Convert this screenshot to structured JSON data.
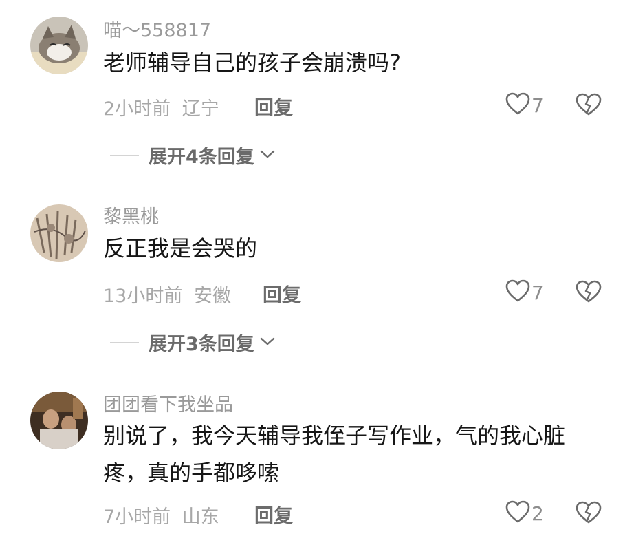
{
  "comments": [
    {
      "username": "喵～558817",
      "text": "老师辅导自己的孩子会崩溃吗?",
      "time": "2小时前",
      "location": "辽宁",
      "reply_label": "回复",
      "likes": "7",
      "expand_label": "展开4条回复"
    },
    {
      "username": "黎黑桃",
      "text": "反正我是会哭的",
      "time": "13小时前",
      "location": "安徽",
      "reply_label": "回复",
      "likes": "7",
      "expand_label": "展开3条回复"
    },
    {
      "username": "团团看下我坐品",
      "text": "别说了，我今天辅导我侄子写作业，气的我心脏疼，真的手都哆嗦",
      "time": "7小时前",
      "location": "山东",
      "reply_label": "回复",
      "likes": "2"
    }
  ],
  "icons": {
    "like": "heart-outline-icon",
    "dislike": "broken-heart-icon",
    "expand": "chevron-down-icon"
  },
  "colors": {
    "username": "#9a9a9a",
    "text": "#161616",
    "meta": "#a7a7a7",
    "reply": "#6c6c6c"
  }
}
